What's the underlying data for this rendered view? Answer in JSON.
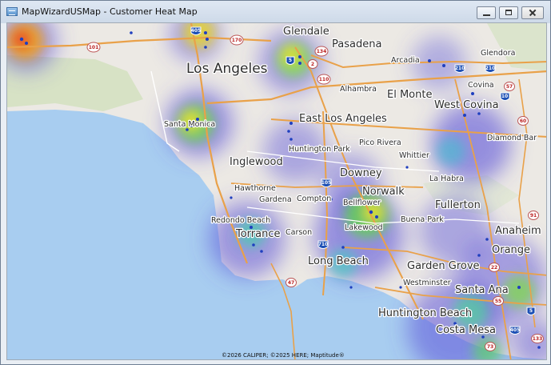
{
  "window": {
    "title": "MapWizardUSMap - Customer Heat Map"
  },
  "cities": {
    "los_angeles": "Los Angeles",
    "glendale": "Glendale",
    "pasadena": "Pasadena",
    "arcadia": "Arcadia",
    "glendora": "Glendora",
    "alhambra": "Alhambra",
    "el_monte": "El Monte",
    "covina": "Covina",
    "west_covina": "West Covina",
    "santa_monica": "Santa Monica",
    "east_los_angeles": "East Los Angeles",
    "diamond_bar": "Diamond Bar",
    "huntington_park": "Huntington Park",
    "pico_rivera": "Pico Rivera",
    "whittier": "Whittier",
    "inglewood": "Inglewood",
    "downey": "Downey",
    "la_habra": "La Habra",
    "hawthorne": "Hawthorne",
    "norwalk": "Norwalk",
    "fullerton": "Fullerton",
    "gardena": "Gardena",
    "compton": "Compton",
    "bellflower": "Bellflower",
    "redondo_beach": "Redondo Beach",
    "buena_park": "Buena Park",
    "anaheim": "Anaheim",
    "torrance": "Torrance",
    "carson": "Carson",
    "lakewood": "Lakewood",
    "orange": "Orange",
    "long_beach": "Long Beach",
    "garden_grove": "Garden Grove",
    "westminster": "Westminster",
    "santa_ana": "Santa Ana",
    "huntington_beach": "Huntington Beach",
    "costa_mesa": "Costa Mesa"
  },
  "shields": {
    "i405_top": "405",
    "s170": "170",
    "s101": "101",
    "s134": "134",
    "i5_glendale": "5",
    "s2": "2",
    "i210_arcadia": "210",
    "i210_glendora": "210",
    "s110": "110",
    "s57": "57",
    "i10": "10",
    "s60": "60",
    "i105": "105",
    "s91": "91",
    "i710": "710",
    "s22": "22",
    "s47": "47",
    "s55": "55",
    "i5_sa": "5",
    "i405_sa": "405",
    "s73": "73",
    "s133": "133"
  },
  "map": {
    "copyright": "©2026 CALIPER; ©2025 HERE; Maptitude®"
  }
}
